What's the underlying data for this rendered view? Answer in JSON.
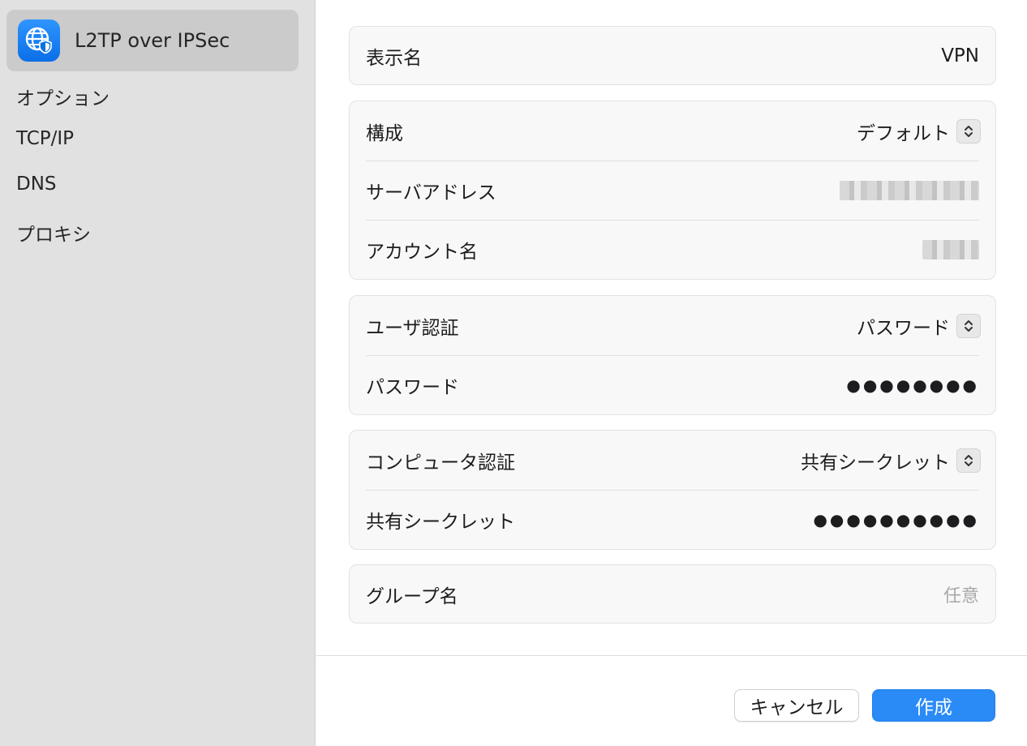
{
  "sidebar": {
    "selected": {
      "label": "L2TP over IPSec",
      "icon": "globe-shield-icon"
    },
    "items": [
      {
        "label": "オプション"
      },
      {
        "label": "TCP/IP"
      },
      {
        "label": "DNS"
      },
      {
        "label": "プロキシ"
      }
    ]
  },
  "form": {
    "display_name": {
      "label": "表示名",
      "value": "VPN"
    },
    "config": {
      "configuration": {
        "label": "構成",
        "value": "デフォルト"
      },
      "server_address": {
        "label": "サーバアドレス"
      },
      "account_name": {
        "label": "アカウント名"
      }
    },
    "user_auth": {
      "method": {
        "label": "ユーザ認証",
        "value": "パスワード"
      },
      "password": {
        "label": "パスワード",
        "value": "●●●●●●●●"
      }
    },
    "machine_auth": {
      "method": {
        "label": "コンピュータ認証",
        "value": "共有シークレット"
      },
      "shared_secret": {
        "label": "共有シークレット",
        "value": "●●●●●●●●●●"
      }
    },
    "group_name": {
      "label": "グループ名",
      "placeholder": "任意"
    }
  },
  "buttons": {
    "cancel": "キャンセル",
    "create": "作成"
  },
  "colors": {
    "accent": "#2a8bf7",
    "sidebar_bg": "#e1e1e1",
    "selected_bg": "#cbcbcb"
  }
}
